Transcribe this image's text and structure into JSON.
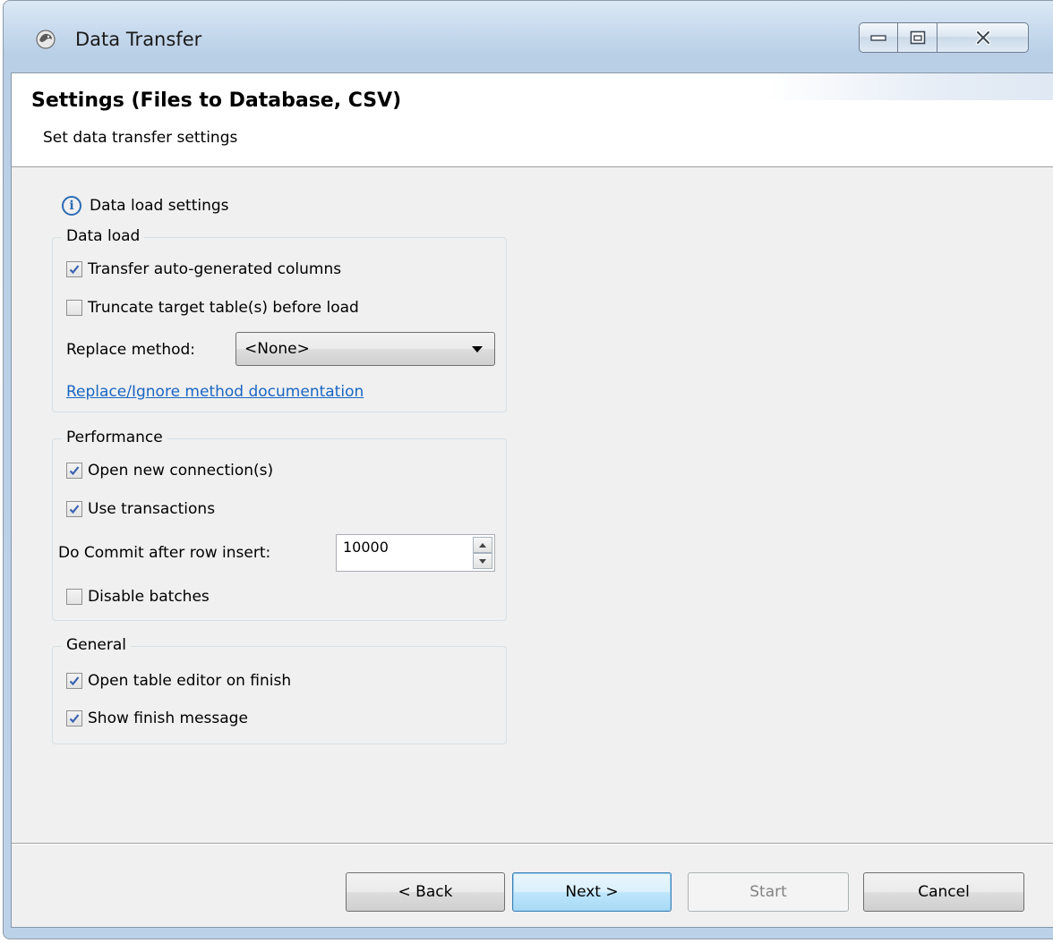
{
  "window": {
    "title": "Data Transfer"
  },
  "banner": {
    "title": "Settings (Files to Database, CSV)",
    "subtitle": "Set data transfer settings"
  },
  "info": {
    "text": "Data load settings",
    "icon": "info-icon"
  },
  "data_load": {
    "legend": "Data load",
    "transfer_auto_generated": {
      "label": "Transfer auto-generated columns",
      "checked": true
    },
    "truncate_target": {
      "label": "Truncate target table(s) before load",
      "checked": false
    },
    "replace_method_label": "Replace method:",
    "replace_method_value": "<None>",
    "doc_link": "Replace/Ignore method documentation"
  },
  "performance": {
    "legend": "Performance",
    "open_new_connections": {
      "label": "Open new connection(s)",
      "checked": true
    },
    "use_transactions": {
      "label": "Use transactions",
      "checked": true
    },
    "commit_label": "Do Commit after row insert:",
    "commit_value": "10000",
    "disable_batches": {
      "label": "Disable batches",
      "checked": false
    }
  },
  "general": {
    "legend": "General",
    "open_table_editor": {
      "label": "Open table editor on finish",
      "checked": true
    },
    "show_finish_message": {
      "label": "Show finish message",
      "checked": true
    }
  },
  "buttons": {
    "back": "< Back",
    "next": "Next >",
    "start": "Start",
    "cancel": "Cancel"
  },
  "colors": {
    "link": "#1a66c2",
    "check": "#3a62b0"
  }
}
